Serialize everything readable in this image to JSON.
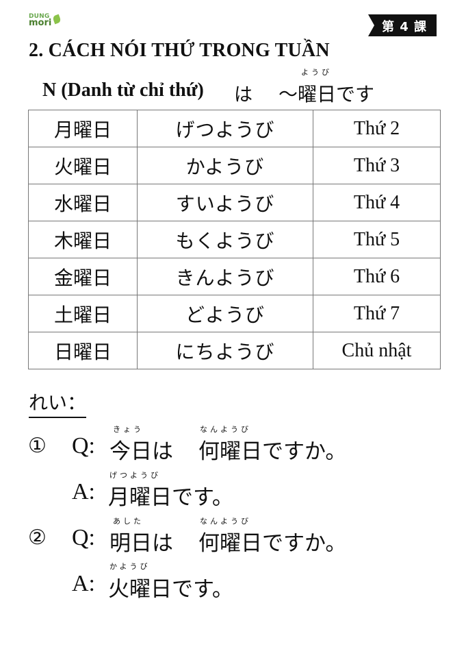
{
  "logo": {
    "line1": "DUNG",
    "line2": "mori"
  },
  "lesson_tag": "第 4 課",
  "title": "2. CÁCH NÓI THỨ TRONG TUẦN",
  "pattern": {
    "prefix": "N (Danh từ chỉ thứ)",
    "particle": "は",
    "suffix": "～曜日です",
    "furigana": "ようび"
  },
  "days": [
    {
      "kanji": "月曜日",
      "hiragana": "げつようび",
      "meaning": "Thứ 2"
    },
    {
      "kanji": "火曜日",
      "hiragana": "かようび",
      "meaning": "Thứ 3"
    },
    {
      "kanji": "水曜日",
      "hiragana": "すいようび",
      "meaning": "Thứ 4"
    },
    {
      "kanji": "木曜日",
      "hiragana": "もくようび",
      "meaning": "Thứ 5"
    },
    {
      "kanji": "金曜日",
      "hiragana": "きんようび",
      "meaning": "Thứ 6"
    },
    {
      "kanji": "土曜日",
      "hiragana": "どようび",
      "meaning": "Thứ 7"
    },
    {
      "kanji": "日曜日",
      "hiragana": "にちようび",
      "meaning": "Chủ nhật"
    }
  ],
  "examples_label": "れい：",
  "examples": [
    {
      "num": "①",
      "q_label": "Q:",
      "q_part1": "今日は",
      "q_part2": "何曜日ですか。",
      "q_furi1": "きょう",
      "q_furi2": "なんようび",
      "a_label": "A:",
      "a_text": "月曜日です。",
      "a_furi": "げつようび"
    },
    {
      "num": "②",
      "q_label": "Q:",
      "q_part1": "明日は",
      "q_part2": "何曜日ですか。",
      "q_furi1": "あした",
      "q_furi2": "なんようび",
      "a_label": "A:",
      "a_text": "火曜日です。",
      "a_furi": "かようび"
    }
  ]
}
